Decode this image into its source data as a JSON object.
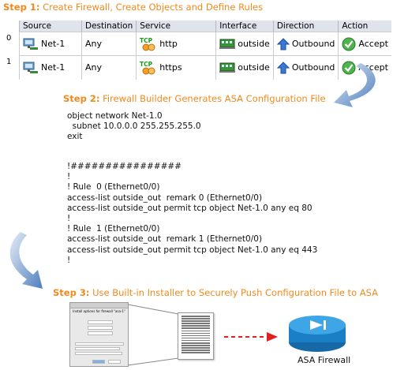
{
  "step1": {
    "lead": "Step 1:",
    "rest": " Create Firewall, Create Objects and Define Rules"
  },
  "table": {
    "columns": [
      "Source",
      "Destination",
      "Service",
      "Interface",
      "Direction",
      "Action"
    ],
    "rows": [
      {
        "num": "0",
        "source": "Net-1",
        "destination": "Any",
        "service": "http",
        "interface": "outside",
        "direction": "Outbound",
        "action": "Accept"
      },
      {
        "num": "1",
        "source": "Net-1",
        "destination": "Any",
        "service": "https",
        "interface": "outside",
        "direction": "Outbound",
        "action": "Accept"
      }
    ],
    "service_icon_text": "TCP"
  },
  "step2": {
    "lead": "Step 2:",
    "rest": " Firewall Builder Generates ASA Configuration File"
  },
  "config_block1": "object network Net-1.0\n  subnet 10.0.0.0 255.255.255.0\nexit",
  "config_block2": "!################\n!\n! Rule  0 (Ethernet0/0)\naccess-list outside_out  remark 0 (Ethernet0/0)\naccess-list outside_out permit tcp object Net-1.0 any eq 80\n!\n! Rule  1 (Ethernet0/0)\naccess-list outside_out  remark 1 (Ethernet0/0)\naccess-list outside_out permit tcp object Net-1.0 any eq 443\n!",
  "step3": {
    "lead": "Step 3:",
    "rest": " Use Built-in Installer to Securely Push Configuration File to ASA"
  },
  "installer": {
    "title": "Install options for firewall \"asa-1\""
  },
  "asa_label": "ASA Firewall",
  "colors": {
    "step_title": "#f08a1c",
    "arrow": "#5a86c0",
    "dashed": "#e02020",
    "asa": "#1f8fd1"
  }
}
